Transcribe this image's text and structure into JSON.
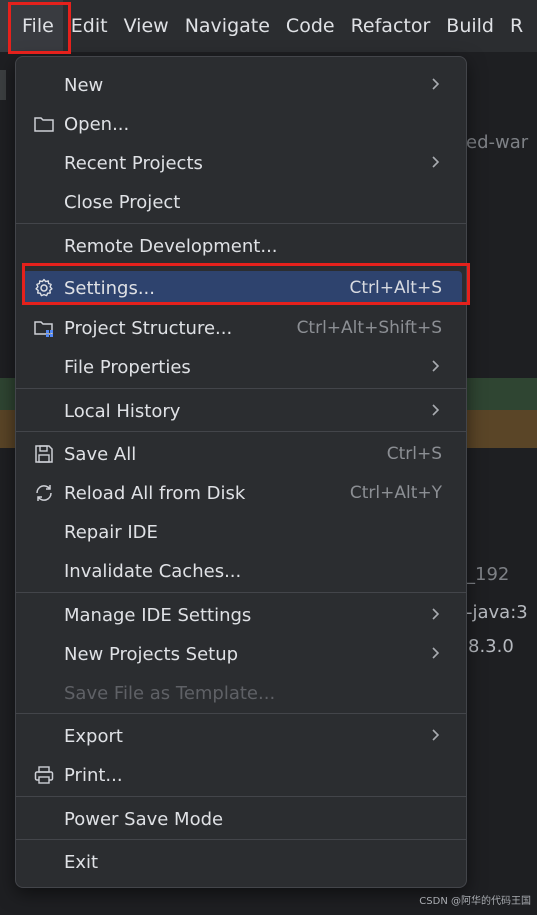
{
  "menubar": {
    "items": [
      "File",
      "Edit",
      "View",
      "Navigate",
      "Code",
      "Refactor",
      "Build",
      "R"
    ]
  },
  "background": {
    "text1": "ed-war",
    "text2": "_192",
    "text3": "-java:3",
    "text4": "8.3.0"
  },
  "menu": {
    "items": [
      {
        "label": "New",
        "shortcut": "",
        "submenu": true,
        "icon": ""
      },
      {
        "label": "Open...",
        "shortcut": "",
        "submenu": false,
        "icon": "folder-icon"
      },
      {
        "label": "Recent Projects",
        "shortcut": "",
        "submenu": true,
        "icon": ""
      },
      {
        "label": "Close Project",
        "shortcut": "",
        "submenu": false,
        "icon": ""
      },
      {
        "label": "Remote Development...",
        "shortcut": "",
        "submenu": false,
        "icon": ""
      },
      {
        "label": "Settings...",
        "shortcut": "Ctrl+Alt+S",
        "submenu": false,
        "icon": "gear-icon",
        "selected": true
      },
      {
        "label": "Project Structure...",
        "shortcut": "Ctrl+Alt+Shift+S",
        "submenu": false,
        "icon": "project-structure-icon"
      },
      {
        "label": "File Properties",
        "shortcut": "",
        "submenu": true,
        "icon": ""
      },
      {
        "label": "Local History",
        "shortcut": "",
        "submenu": true,
        "icon": ""
      },
      {
        "label": "Save All",
        "shortcut": "Ctrl+S",
        "submenu": false,
        "icon": "save-icon"
      },
      {
        "label": "Reload All from Disk",
        "shortcut": "Ctrl+Alt+Y",
        "submenu": false,
        "icon": "reload-icon"
      },
      {
        "label": "Repair IDE",
        "shortcut": "",
        "submenu": false,
        "icon": ""
      },
      {
        "label": "Invalidate Caches...",
        "shortcut": "",
        "submenu": false,
        "icon": ""
      },
      {
        "label": "Manage IDE Settings",
        "shortcut": "",
        "submenu": true,
        "icon": ""
      },
      {
        "label": "New Projects Setup",
        "shortcut": "",
        "submenu": true,
        "icon": ""
      },
      {
        "label": "Save File as Template...",
        "shortcut": "",
        "submenu": false,
        "icon": "",
        "disabled": true
      },
      {
        "label": "Export",
        "shortcut": "",
        "submenu": true,
        "icon": ""
      },
      {
        "label": "Print...",
        "shortcut": "",
        "submenu": false,
        "icon": "printer-icon"
      },
      {
        "label": "Power Save Mode",
        "shortcut": "",
        "submenu": false,
        "icon": ""
      },
      {
        "label": "Exit",
        "shortcut": "",
        "submenu": false,
        "icon": ""
      }
    ]
  },
  "watermark": "CSDN @阿华的代码王国",
  "colors": {
    "accent_selected": "#2e436e",
    "highlight_red": "#e5211c"
  }
}
